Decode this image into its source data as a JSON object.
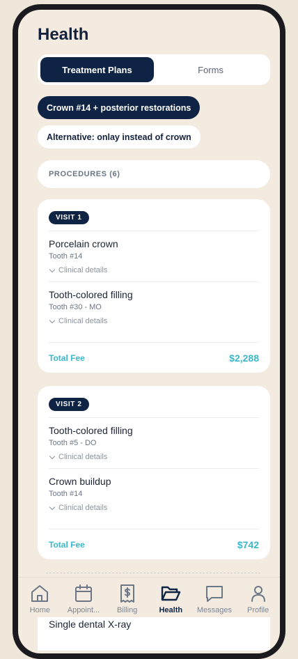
{
  "page": {
    "title": "Health"
  },
  "segments": {
    "treatment_plans": "Treatment Plans",
    "forms": "Forms"
  },
  "plans": {
    "primary": "Crown #14 + posterior restorations",
    "alternative": "Alternative: onlay instead of crown"
  },
  "procedures_header": "PROCEDURES (6)",
  "details_label": "Clinical details",
  "total_label": "Total Fee",
  "visits": [
    {
      "badge": "VISIT 1",
      "procedures": [
        {
          "name": "Porcelain crown",
          "tooth": "Tooth #14"
        },
        {
          "name": "Tooth-colored filling",
          "tooth": "Tooth #30 - MO"
        }
      ],
      "total": "$2,288"
    },
    {
      "badge": "VISIT 2",
      "procedures": [
        {
          "name": "Tooth-colored filling",
          "tooth": "Tooth #5 - DO"
        },
        {
          "name": "Crown buildup",
          "tooth": "Tooth #14"
        }
      ],
      "total": "$742"
    }
  ],
  "peek_item": "Single dental X-ray",
  "tabs": [
    {
      "label": "Home",
      "icon": "home-icon"
    },
    {
      "label": "Appoint...",
      "icon": "calendar-icon"
    },
    {
      "label": "Billing",
      "icon": "receipt-dollar-icon"
    },
    {
      "label": "Health",
      "icon": "folder-open-icon",
      "active": true
    },
    {
      "label": "Messages",
      "icon": "chat-bubble-icon"
    },
    {
      "label": "Profile",
      "icon": "person-icon"
    }
  ],
  "colors": {
    "navy": "#0f2444",
    "accent": "#3bb7cc",
    "background": "#f3ebe0"
  }
}
